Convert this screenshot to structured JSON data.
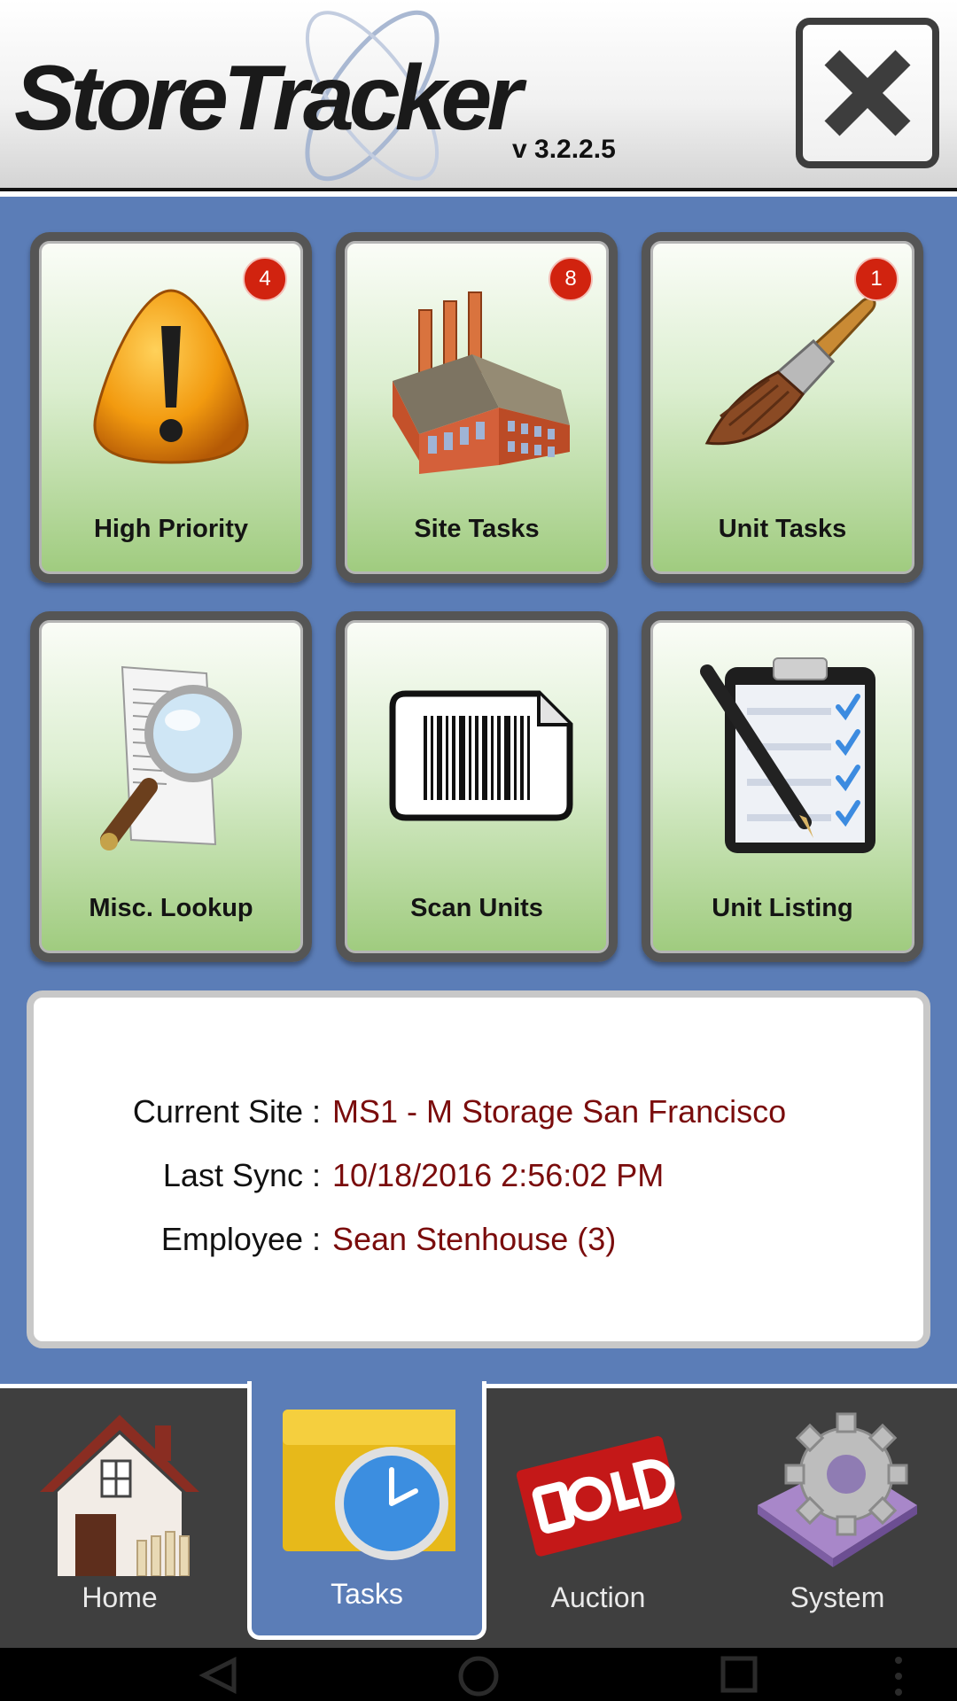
{
  "header": {
    "logo_text": "StoreTracker",
    "version": "v 3.2.2.5",
    "close_icon": "close-icon"
  },
  "tiles": [
    {
      "label": "High Priority",
      "badge": "4",
      "icon": "warning-icon"
    },
    {
      "label": "Site Tasks",
      "badge": "8",
      "icon": "factory-icon"
    },
    {
      "label": "Unit Tasks",
      "badge": "1",
      "icon": "paintbrush-icon"
    },
    {
      "label": "Misc. Lookup",
      "badge": "",
      "icon": "magnifier-document-icon"
    },
    {
      "label": "Scan Units",
      "badge": "",
      "icon": "barcode-icon"
    },
    {
      "label": "Unit Listing",
      "badge": "",
      "icon": "clipboard-checklist-icon"
    }
  ],
  "info": {
    "current_site_label": "Current Site :",
    "current_site_value": "MS1 - M Storage San Francisco",
    "last_sync_label": "Last Sync :",
    "last_sync_value": "10/18/2016 2:56:02 PM",
    "employee_label": "Employee :",
    "employee_value": "Sean Stenhouse (3)"
  },
  "nav": {
    "items": [
      {
        "label": "Home",
        "icon": "house-icon"
      },
      {
        "label": "Tasks",
        "icon": "clock-folder-icon",
        "active": true
      },
      {
        "label": "Auction",
        "icon": "sold-sign-icon"
      },
      {
        "label": "System",
        "icon": "gear-icon"
      }
    ]
  },
  "colors": {
    "background_blue": "#5b7db7",
    "badge_red": "#d1230f",
    "info_value": "#7a0c0c",
    "tile_green": "#9fcb7e"
  }
}
